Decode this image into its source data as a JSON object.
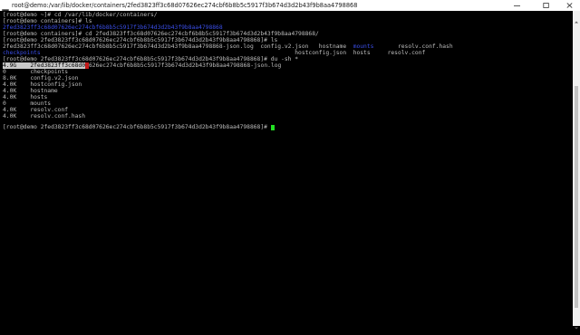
{
  "window": {
    "title": "root@demo:/var/lib/docker/containers/2fed3823ff3c68d07626ec274cbf6b8b5c5917f3b674d3d2b43f9b8aa4798868",
    "icon": "terminal-icon",
    "buttons": [
      "minimize-icon",
      "maximize-icon",
      "close-icon"
    ]
  },
  "colors": {
    "background": "#000000",
    "text": "#bdbdbd",
    "directory": "#3a4ee8",
    "cursor": "#22e022",
    "selection": "#c9c9c9",
    "selection_caret": "#c41a1a"
  },
  "terminal": {
    "l1": "[root@demo ~]# cd /var/lib/docker/containers/",
    "l2": "[root@demo containers]# ls",
    "l3": "2fed3823ff3c68d07626ec274cbf6b8b5c5917f3b674d3d2b43f9b8aa4798868",
    "l4": "[root@demo containers]# cd 2fed3823ff3c68d07626ec274cbf6b8b5c5917f3b674d3d2b43f9b8aa4798868/",
    "l5": "[root@demo 2fed3823ff3c68d07626ec274cbf6b8b5c5917f3b674d3d2b43f9b8aa4798868]# ls",
    "l6_a": "2fed3823ff3c68d07626ec274cbf6b8b5c5917f3b674d3d2b43f9b8aa4798868-json.log  config.v2.json   hostname  ",
    "l6_b": "mounts",
    "l6_c": "       resolv.conf.hash",
    "l7_a": "checkpoints",
    "l7_b": "                                                                          hostconfig.json  hosts     resolv.conf",
    "l8": "[root@demo 2fed3823ff3c68d07626ec274cbf6b8b5c5917f3b674d3d2b43f9b8aa4798868]# du -sh *",
    "l9_size": "4.9G",
    "l9_gap": "    ",
    "l9_sel": "2fed3823ff3c68d0",
    "l9_caret": "7",
    "l9_rest": "626ec274cbf6b8b5c5917f3b674d3d2b43f9b8aa4798868-json.log",
    "l10": "0       checkpoints",
    "l11": "8.0K    config.v2.json",
    "l12": "4.0K    hostconfig.json",
    "l13": "4.0K    hostname",
    "l14": "4.0K    hosts",
    "l15": "0       mounts",
    "l16": "4.0K    resolv.conf",
    "l17": "4.0K    resolv.conf.hash",
    "l18": "[root@demo 2fed3823ff3c68d07626ec274cbf6b8b5c5917f3b674d3d2b43f9b8aa4798868]# "
  }
}
